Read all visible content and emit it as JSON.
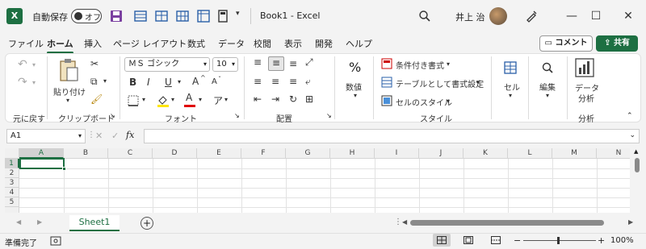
{
  "titlebar": {
    "logo": "X",
    "autosave_label": "自動保存",
    "autosave_state": "オフ",
    "doc_title": "Book1  -  Excel",
    "user_name": "井上 治",
    "minimize": "—",
    "maximize": "☐",
    "close": "✕"
  },
  "tabs": [
    "ファイル",
    "ホーム",
    "挿入",
    "ページ レイアウト",
    "数式",
    "データ",
    "校閲",
    "表示",
    "開発",
    "ヘルプ"
  ],
  "active_tab": "ホーム",
  "comment_label": "コメント",
  "share_label": "共有",
  "ribbon": {
    "undo_group": "元に戻す",
    "clipboard": {
      "paste": "貼り付け",
      "group": "クリップボード"
    },
    "font": {
      "name": "ＭＳ ゴシック",
      "size": "10",
      "bold": "B",
      "italic": "I",
      "underline": "U",
      "grow": "A",
      "shrink": "A",
      "color_a": "A",
      "group": "フォント"
    },
    "alignment": {
      "group": "配置"
    },
    "number": {
      "percent": "%",
      "label": "数値"
    },
    "styles": {
      "conditional": "条件付き書式",
      "table": "テーブルとして書式設定",
      "cell_style": "セルのスタイル",
      "group": "スタイル"
    },
    "cells": {
      "label": "セル"
    },
    "editing": {
      "label": "編集"
    },
    "analysis": {
      "label1": "データ",
      "label2": "分析",
      "group": "分析"
    }
  },
  "formula_bar": {
    "name_box": "A1",
    "cancel": "✕",
    "enter": "✓",
    "fx": "fx",
    "value": ""
  },
  "grid": {
    "columns": [
      "A",
      "B",
      "C",
      "D",
      "E",
      "F",
      "G",
      "H",
      "I",
      "J",
      "K",
      "L",
      "M",
      "N"
    ],
    "rows": [
      "1",
      "2",
      "3",
      "4",
      "5"
    ]
  },
  "sheet_tab": "Sheet1",
  "add_sheet": "+",
  "status": {
    "ready": "準備完了",
    "zoom": "100%",
    "minus": "−",
    "plus": "+"
  }
}
